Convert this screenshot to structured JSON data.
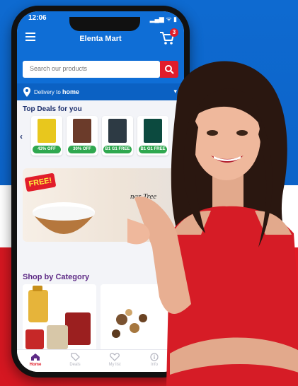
{
  "status_bar": {
    "time": "12:06",
    "icons": "▂▄▆ ᯤ ▮"
  },
  "header": {
    "title": "Elenta Mart",
    "cart_count": "3"
  },
  "search": {
    "placeholder": "Search our products"
  },
  "delivery": {
    "label": "Delivery to",
    "value": "home"
  },
  "top_deals": {
    "title": "Top Deals for you",
    "items": [
      {
        "badge": "43% OFF",
        "color": "#e8c71d"
      },
      {
        "badge": "30% OFF",
        "color": "#6b3b2a"
      },
      {
        "badge": "B1 G1 FREE",
        "color": "#2d3a44"
      },
      {
        "badge": "B1 G1 FREE",
        "color": "#0c4a3f"
      }
    ]
  },
  "promo": {
    "badge": "FREE!",
    "text": "nar Tree"
  },
  "shop_by_category": {
    "title": "Shop by Category"
  },
  "bottom_nav": [
    {
      "label": "Home",
      "icon": "home-icon",
      "active": true
    },
    {
      "label": "Deals",
      "icon": "tag-icon",
      "active": false
    },
    {
      "label": "My list",
      "icon": "heart-icon",
      "active": false
    },
    {
      "label": "Info",
      "icon": "info-icon",
      "active": false
    }
  ],
  "colors": {
    "brand_blue": "#0f6ed6",
    "accent_red": "#e11d2a",
    "deal_green": "#2fa84f"
  }
}
